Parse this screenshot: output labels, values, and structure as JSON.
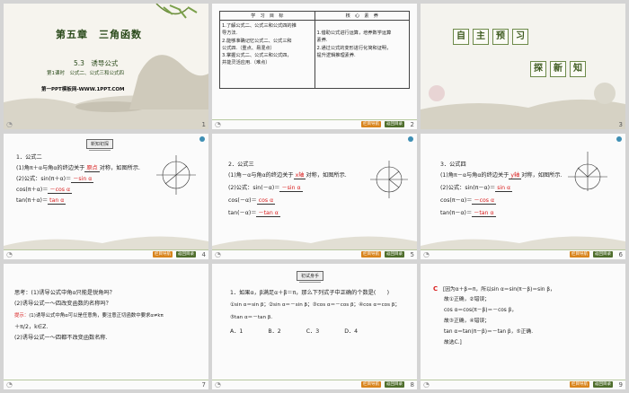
{
  "slides": [
    {
      "num": "1",
      "chapter": "第五章　三角函数",
      "section": "5.3　诱导公式",
      "lesson": "第1课时　公式二、公式三和公式四",
      "site": "第一PPT模板网-WWW.1PPT.COM"
    },
    {
      "num": "2",
      "headers": [
        "学　习　目　标",
        "核　心　素　养"
      ],
      "left": [
        "1.了解公式二、公式三和公式四的推",
        "导方法.",
        "2.能够准确记忆公式二、公式三和",
        "公式四.（重点、易混点）",
        "3.掌握公式二、公式三和公式四，",
        "并能灵活应用.（难点）"
      ],
      "right": [
        "1.借助公式进行运算，培养数学运算",
        "素养.",
        "2.通过公式的变形进行化简和证明，",
        "提升逻辑推理素养."
      ]
    },
    {
      "num": "3",
      "tiles": [
        "自",
        "主",
        "预",
        "习"
      ],
      "tiles2": [
        "探",
        "新",
        "知"
      ]
    },
    {
      "num": "4",
      "badge": "新知初探",
      "title": "1．公式二",
      "line1": "(1)角π＋α与角α的终边关于",
      "line1b": "原点",
      "line1c": "对称，如图所示.",
      "line2": "(2)公式：sin(π＋α)＝",
      "line2a": "－sin α",
      "line3": "cos(π＋α)＝",
      "line3a": "－cos α",
      "line4": "tan(π＋α)＝",
      "line4a": "tan α"
    },
    {
      "num": "5",
      "title": "2．公式三",
      "line1": "(1)角－α与角α的终边关于",
      "line1b": "x轴",
      "line1c": "对称，如图所示.",
      "line2": "(2)公式：sin(－α)＝",
      "line2a": "－sin α",
      "line3": "cos(－α)＝",
      "line3a": "cos α",
      "line4": "tan(－α)＝",
      "line4a": "－tan α"
    },
    {
      "num": "6",
      "title": "3．公式四",
      "line1": "(1)角π－α与角α的终边关于",
      "line1b": "y轴",
      "line1c": "对称，如图所示.",
      "line2": "(2)公式：sin(π－α)＝",
      "line2a": "sin α",
      "line3": "cos(π－α)＝",
      "line3a": "－cos α",
      "line4": "tan(π－α)＝",
      "line4a": "－tan α"
    },
    {
      "num": "7",
      "q1": "思考：(1)诱导公式中角α只能是锐角吗？",
      "q2": "(2)诱导公式一～四改变函数的名称吗？",
      "hint": "提示：",
      "a1": "(1)诱导公式中角α可以是任意角，要注意正切函数中要求α≠kπ",
      "a1b": "＋π/2，k∈Z.",
      "a2": "(2)诱导公式一～四都不改变函数名称."
    },
    {
      "num": "8",
      "badge": "初试身手",
      "q": "1．如果α，β满足α＋β＝π，那么下列式子中正确的个数是(　　)",
      "opts1": "①sin α＝sin β；②sin α＝－sin β；③cos α＝－cos β；④cos α＝cos β；",
      "opts2": "⑤tan α＝－tan β.",
      "choices": [
        "A．1",
        "B．2",
        "C．3",
        "D．4"
      ]
    },
    {
      "num": "9",
      "ans": "C",
      "l1": "[因为α＋β＝π，所以sin α＝sin(π－β)＝sin β，",
      "l2": "故①正确，②错误；",
      "l3": "cos α＝cos(π－β)＝－cos β，",
      "l4": "故③正确，④错误；",
      "l5": "tan α＝tan(π－β)＝－tan β，⑤正确.",
      "l6": "故选C.]"
    }
  ],
  "footer_buttons": [
    "栏目导航",
    "返回目录"
  ],
  "colors": {
    "chapter": "#2a4a1a",
    "accent_green": "#4f6e2c",
    "accent_orange": "#d8841c",
    "red_answer": "#d81c1c",
    "selected_outline": "#f08a24"
  }
}
